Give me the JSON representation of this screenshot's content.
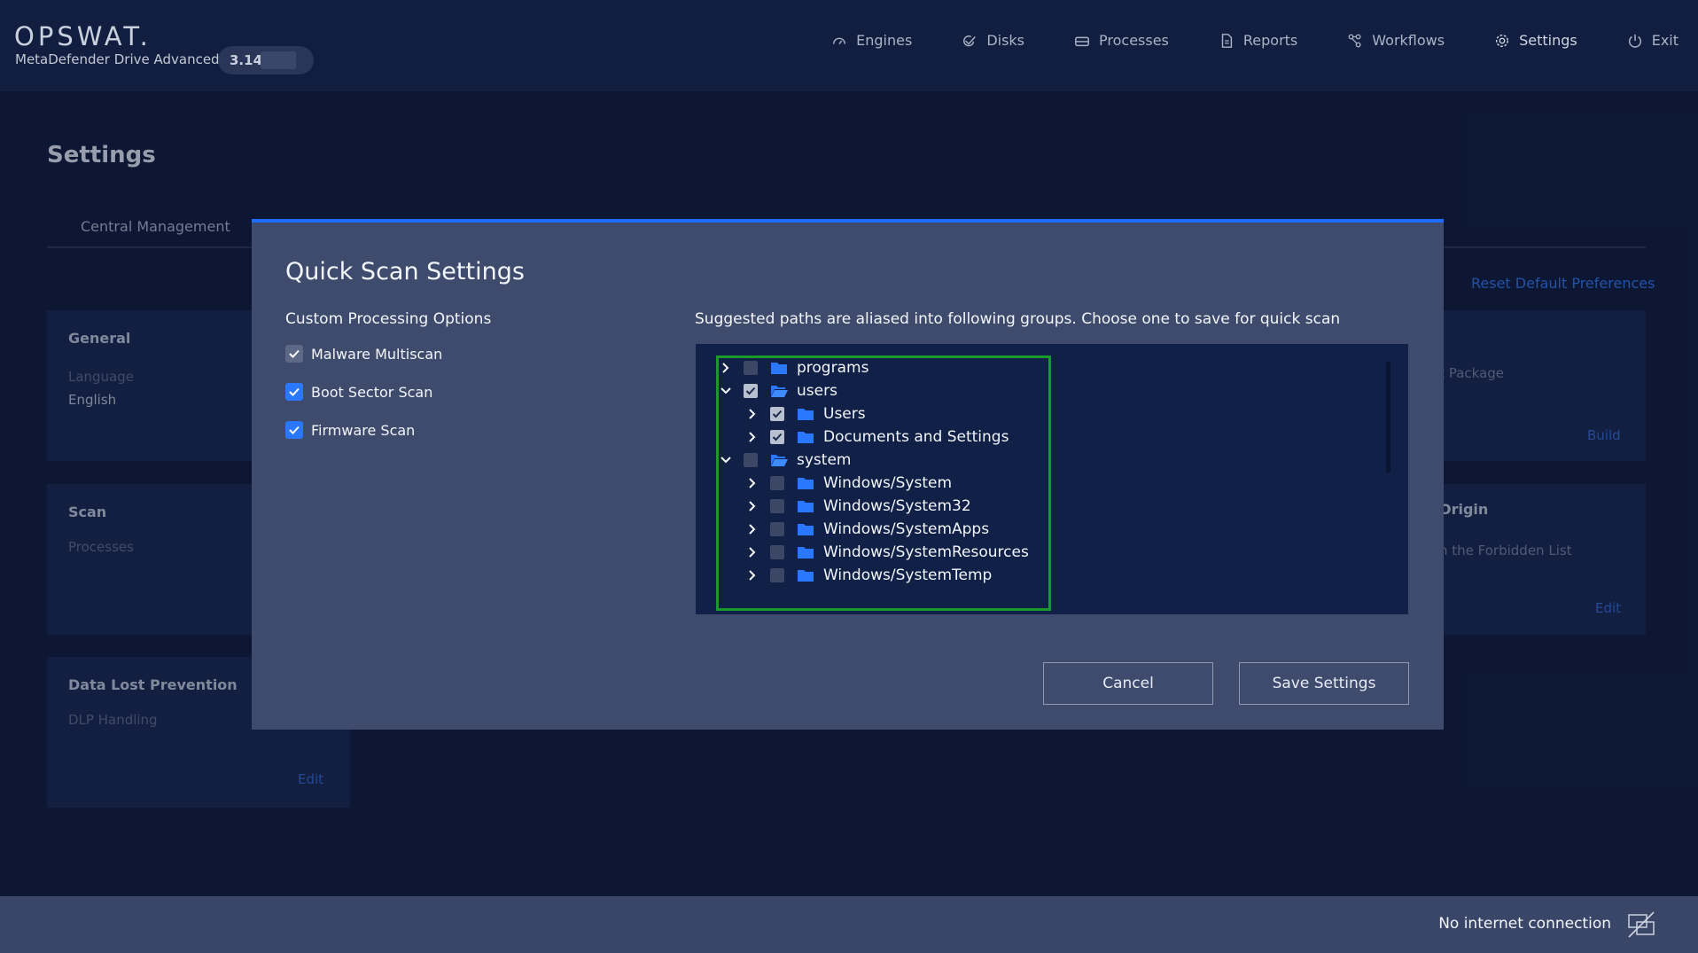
{
  "header": {
    "logo": "OPSWAT.",
    "product": "MetaDefender Drive Advanced",
    "version": "3.14.(",
    "nav": [
      {
        "label": "Engines",
        "icon": "gauge-icon"
      },
      {
        "label": "Disks",
        "icon": "check-shield-icon"
      },
      {
        "label": "Processes",
        "icon": "drive-icon"
      },
      {
        "label": "Reports",
        "icon": "document-icon"
      },
      {
        "label": "Workflows",
        "icon": "workflow-icon"
      },
      {
        "label": "Settings",
        "icon": "gear-icon"
      },
      {
        "label": "Exit",
        "icon": "power-icon"
      }
    ]
  },
  "page": {
    "title": "Settings",
    "tab": "Central Management",
    "reset_link": "Reset Default Preferences",
    "cards": {
      "general": {
        "title": "General",
        "label": "Language",
        "value": "English"
      },
      "scan": {
        "title": "Scan",
        "label": "Processes"
      },
      "dlp": {
        "title": "Data Lost Prevention",
        "label": "DLP Handling",
        "link": "Edit"
      }
    },
    "right_fragments": {
      "package": "rt Package",
      "build": "Build",
      "origin": "Origin",
      "forbidden": "n the Forbidden List",
      "edit": "Edit"
    }
  },
  "modal": {
    "title": "Quick Scan Settings",
    "left_heading": "Custom Processing Options",
    "options": [
      {
        "label": "Malware Multiscan",
        "checked": true,
        "style": "grey"
      },
      {
        "label": "Boot Sector Scan",
        "checked": true,
        "style": "blue"
      },
      {
        "label": "Firmware Scan",
        "checked": true,
        "style": "blue"
      }
    ],
    "right_heading": "Suggested paths are aliased into following groups. Choose one to save for quick scan",
    "tree": [
      {
        "label": "programs",
        "level": 0,
        "expanded": false,
        "checked": false,
        "open_folder": false
      },
      {
        "label": "users",
        "level": 0,
        "expanded": true,
        "checked": true,
        "open_folder": true
      },
      {
        "label": "Users",
        "level": 1,
        "expanded": false,
        "checked": true,
        "open_folder": false
      },
      {
        "label": "Documents and Settings",
        "level": 1,
        "expanded": false,
        "checked": true,
        "open_folder": false
      },
      {
        "label": "system",
        "level": 0,
        "expanded": true,
        "checked": false,
        "open_folder": true
      },
      {
        "label": "Windows/System",
        "level": 1,
        "expanded": false,
        "checked": false,
        "open_folder": false
      },
      {
        "label": "Windows/System32",
        "level": 1,
        "expanded": false,
        "checked": false,
        "open_folder": false
      },
      {
        "label": "Windows/SystemApps",
        "level": 1,
        "expanded": false,
        "checked": false,
        "open_folder": false
      },
      {
        "label": "Windows/SystemResources",
        "level": 1,
        "expanded": false,
        "checked": false,
        "open_folder": false
      },
      {
        "label": "Windows/SystemTemp",
        "level": 1,
        "expanded": false,
        "checked": false,
        "open_folder": false
      }
    ],
    "cancel": "Cancel",
    "save": "Save Settings"
  },
  "footer": {
    "status": "No internet connection"
  },
  "colors": {
    "accent": "#1f6bff",
    "folder": "#2a78ff",
    "highlight_border": "#1a9a2a"
  }
}
